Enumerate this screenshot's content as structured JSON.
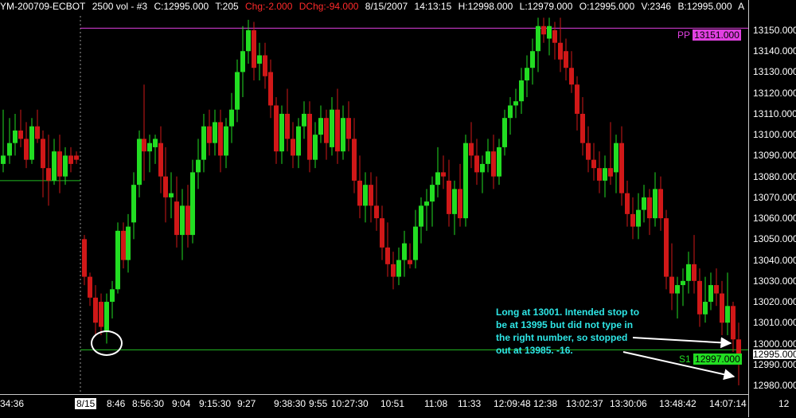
{
  "header": {
    "symbol": "YM-200709-ECBOT",
    "interval": "2500 vol - #3",
    "close": "C:12995.000",
    "ticks": "T:205",
    "change": "Chg:-2.000",
    "dchange": "DChg:-94.000",
    "date": "8/15/2007",
    "time": "14:13:15",
    "high": "H:12998.000",
    "low": "L:12979.000",
    "open": "O:12995.000",
    "volume": "V:2346",
    "bid": "B:12995.000",
    "extra": "A"
  },
  "price_axis": [
    "13150.000",
    "13140.000",
    "13130.000",
    "13120.000",
    "13110.000",
    "13100.000",
    "13090.000",
    "13080.000",
    "13070.000",
    "13060.000",
    "13050.000",
    "13040.000",
    "13030.000",
    "13020.000",
    "13010.000",
    "13000.000",
    "12995.000",
    "12990.000",
    "12980.000"
  ],
  "time_axis": [
    "34:36",
    "8/15",
    "8:46",
    "8:56:30",
    "9:04",
    "9:15:30",
    "9:27",
    "9:38:30",
    "9:55",
    "10:27:30",
    "10:51",
    "11:08",
    "11:33",
    "12:09:48",
    "12:38",
    "13:02:37",
    "13:30:06",
    "13:48:42",
    "14:07:14",
    "12"
  ],
  "levels": {
    "pp_label": "PP",
    "pp_value": "13151.000",
    "s1_label": "S1",
    "s1_value": "12997.000"
  },
  "annotation": "Long at 13001.  Intended stop to be at 13995 but did not type in the right number, so stopped out at 13985.  -16.",
  "colors": {
    "up": "#22dd22",
    "down": "#d01818",
    "pp_line": "#e040e0",
    "s1_line": "#22bb22",
    "annotation": "#2ee6e6"
  }
}
